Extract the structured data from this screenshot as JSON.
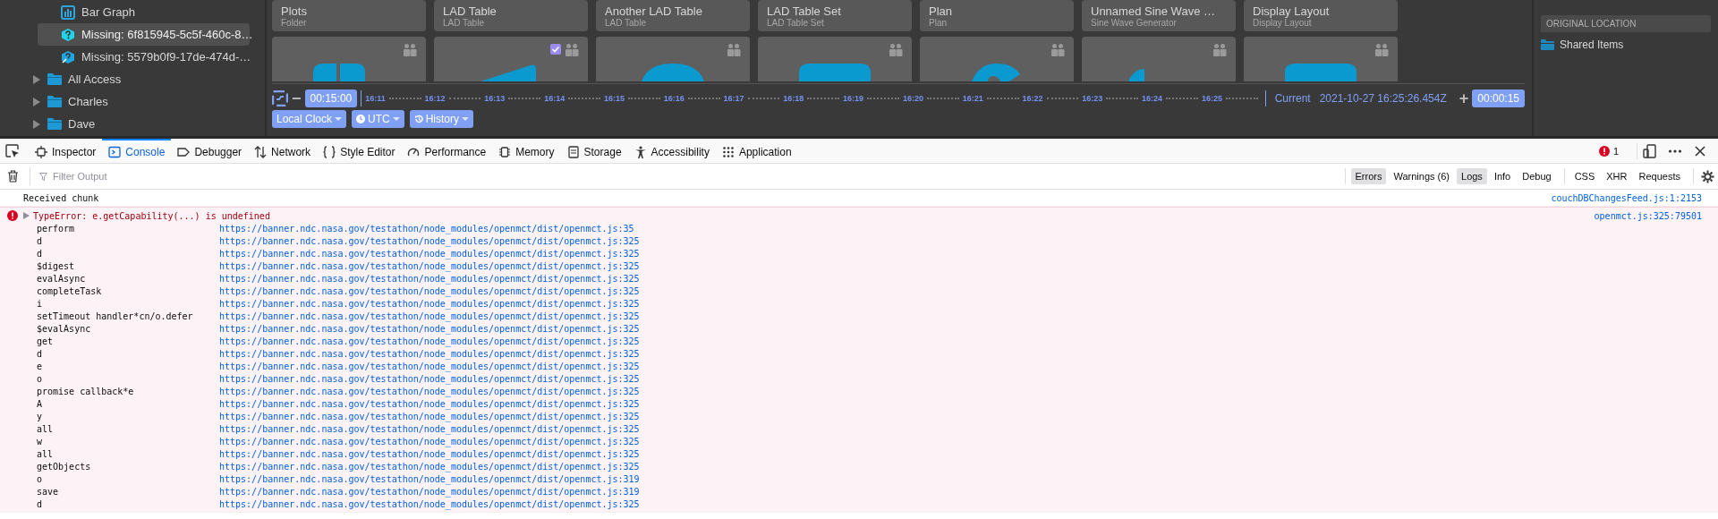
{
  "sidebar": {
    "tree": [
      {
        "children": [
          {
            "label": "Bar Graph",
            "kind": "bar-graph",
            "selected": false
          },
          {
            "label": "Missing: 6f815945-5c5f-460c-8…",
            "kind": "missing",
            "selected": true
          },
          {
            "label": "Missing: 5579b0f9-17de-474d-…",
            "kind": "missing-link",
            "selected": false
          }
        ]
      },
      {
        "label": "All Access",
        "kind": "folder",
        "expanded": false,
        "selected": false
      },
      {
        "label": "Charles",
        "kind": "folder",
        "expanded": false,
        "selected": false
      },
      {
        "label": "Dave",
        "kind": "folder",
        "expanded": false,
        "selected": false
      }
    ]
  },
  "grid": {
    "cards": [
      {
        "title": "Plots",
        "type": "Folder",
        "kind": "folder",
        "checked": false
      },
      {
        "title": "LAD Table",
        "type": "LAD Table",
        "kind": "lad-table",
        "checked": true
      },
      {
        "title": "Another LAD Table",
        "type": "LAD Table",
        "kind": "lad-table-round",
        "checked": false
      },
      {
        "title": "LAD Table Set",
        "type": "LAD Table Set",
        "kind": "lad-table-set",
        "checked": false
      },
      {
        "title": "Plan",
        "type": "Plan",
        "kind": "plan",
        "checked": false
      },
      {
        "title": "Unnamed Sine Wave …",
        "type": "Sine Wave Generator",
        "kind": "sine-wave",
        "checked": false
      },
      {
        "title": "Display Layout",
        "type": "Display Layout",
        "kind": "display-layout",
        "checked": false
      }
    ]
  },
  "time_conductor": {
    "minus": "−",
    "start_offset": "00:15:00",
    "ticks": [
      "16:11",
      "16:12",
      "16:13",
      "16:14",
      "16:15",
      "16:16",
      "16:17",
      "16:18",
      "16:19",
      "16:20",
      "16:21",
      "16:22",
      "16:23",
      "16:24",
      "16:25"
    ],
    "current_label": "Current",
    "current_time": "2021-10-27 16:25:26.454Z",
    "plus": "+",
    "end_offset": "00:00:15",
    "menus": [
      {
        "label": "Local Clock",
        "kind": "plain"
      },
      {
        "label": "UTC",
        "kind": "clock"
      },
      {
        "label": "History",
        "kind": "history"
      }
    ]
  },
  "inspector": {
    "header": "ORIGINAL LOCATION",
    "location": "Shared Items"
  },
  "devtools": {
    "tabs": [
      {
        "label": "Inspector",
        "kind": "inspector",
        "selected": false
      },
      {
        "label": "Console",
        "kind": "console",
        "selected": true
      },
      {
        "label": "Debugger",
        "kind": "debugger",
        "selected": false
      },
      {
        "label": "Network",
        "kind": "network",
        "selected": false
      },
      {
        "label": "Style Editor",
        "kind": "style",
        "selected": false
      },
      {
        "label": "Performance",
        "kind": "performance",
        "selected": false
      },
      {
        "label": "Memory",
        "kind": "memory",
        "selected": false
      },
      {
        "label": "Storage",
        "kind": "storage",
        "selected": false
      },
      {
        "label": "Accessibility",
        "kind": "accessibility",
        "selected": false
      },
      {
        "label": "Application",
        "kind": "application",
        "selected": false
      }
    ],
    "error_count": "1",
    "filter": {
      "placeholder": "Filter Output"
    },
    "levels": [
      {
        "label": "Errors",
        "selected": true
      },
      {
        "label": "Warnings (6)",
        "selected": false
      },
      {
        "label": "Logs",
        "selected": true
      },
      {
        "label": "Info",
        "selected": false
      },
      {
        "label": "Debug",
        "selected": false
      }
    ],
    "requests": [
      {
        "label": "CSS",
        "selected": false
      },
      {
        "label": "XHR",
        "selected": false
      },
      {
        "label": "Requests",
        "selected": false
      }
    ],
    "console": {
      "messages": [
        {
          "kind": "log",
          "text": "Received chunk",
          "source": "couchDBChangesFeed.js:1:2153"
        },
        {
          "kind": "error",
          "text": "TypeError: e.getCapability(...) is undefined",
          "source": "openmct.js:325:79501",
          "stack": [
            {
              "fn": "perform",
              "url": "https://banner.ndc.nasa.gov/testathon/node_modules/openmct/dist/openmct.js:35"
            },
            {
              "fn": "d",
              "url": "https://banner.ndc.nasa.gov/testathon/node_modules/openmct/dist/openmct.js:325"
            },
            {
              "fn": "d",
              "url": "https://banner.ndc.nasa.gov/testathon/node_modules/openmct/dist/openmct.js:325"
            },
            {
              "fn": "$digest",
              "url": "https://banner.ndc.nasa.gov/testathon/node_modules/openmct/dist/openmct.js:325"
            },
            {
              "fn": "evalAsync",
              "url": "https://banner.ndc.nasa.gov/testathon/node_modules/openmct/dist/openmct.js:325"
            },
            {
              "fn": "completeTask",
              "url": "https://banner.ndc.nasa.gov/testathon/node_modules/openmct/dist/openmct.js:325"
            },
            {
              "fn": "i",
              "url": "https://banner.ndc.nasa.gov/testathon/node_modules/openmct/dist/openmct.js:325"
            },
            {
              "fn": "setTimeout handler*cn/o.defer",
              "url": "https://banner.ndc.nasa.gov/testathon/node_modules/openmct/dist/openmct.js:325"
            },
            {
              "fn": "$evalAsync",
              "url": "https://banner.ndc.nasa.gov/testathon/node_modules/openmct/dist/openmct.js:325"
            },
            {
              "fn": "get",
              "url": "https://banner.ndc.nasa.gov/testathon/node_modules/openmct/dist/openmct.js:325"
            },
            {
              "fn": "d",
              "url": "https://banner.ndc.nasa.gov/testathon/node_modules/openmct/dist/openmct.js:325"
            },
            {
              "fn": "e",
              "url": "https://banner.ndc.nasa.gov/testathon/node_modules/openmct/dist/openmct.js:325"
            },
            {
              "fn": "o",
              "url": "https://banner.ndc.nasa.gov/testathon/node_modules/openmct/dist/openmct.js:325"
            },
            {
              "fn": "promise callback*e",
              "url": "https://banner.ndc.nasa.gov/testathon/node_modules/openmct/dist/openmct.js:325"
            },
            {
              "fn": "A",
              "url": "https://banner.ndc.nasa.gov/testathon/node_modules/openmct/dist/openmct.js:325"
            },
            {
              "fn": "y",
              "url": "https://banner.ndc.nasa.gov/testathon/node_modules/openmct/dist/openmct.js:325"
            },
            {
              "fn": "all",
              "url": "https://banner.ndc.nasa.gov/testathon/node_modules/openmct/dist/openmct.js:325"
            },
            {
              "fn": "w",
              "url": "https://banner.ndc.nasa.gov/testathon/node_modules/openmct/dist/openmct.js:325"
            },
            {
              "fn": "all",
              "url": "https://banner.ndc.nasa.gov/testathon/node_modules/openmct/dist/openmct.js:325"
            },
            {
              "fn": "getObjects",
              "url": "https://banner.ndc.nasa.gov/testathon/node_modules/openmct/dist/openmct.js:325"
            },
            {
              "fn": "o",
              "url": "https://banner.ndc.nasa.gov/testathon/node_modules/openmct/dist/openmct.js:319"
            },
            {
              "fn": "save",
              "url": "https://banner.ndc.nasa.gov/testathon/node_modules/openmct/dist/openmct.js:319"
            },
            {
              "fn": "d",
              "url": "https://banner.ndc.nasa.gov/testathon/node_modules/openmct/dist/openmct.js:325"
            }
          ]
        }
      ]
    }
  }
}
